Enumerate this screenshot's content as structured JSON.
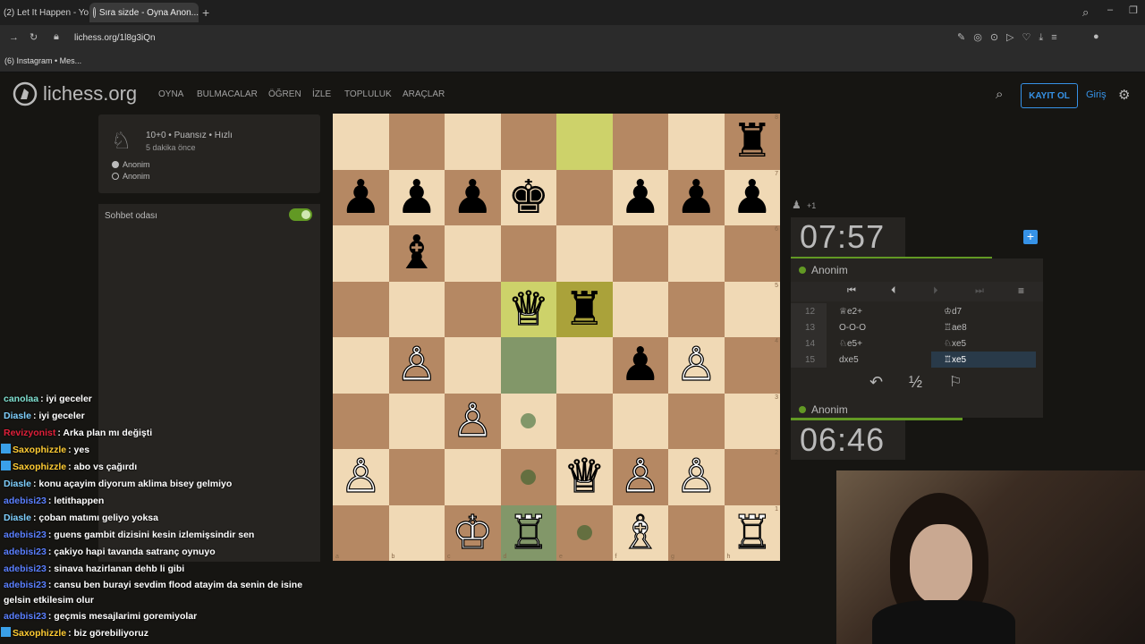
{
  "browser": {
    "tabs": [
      {
        "label": "(2) Let It Happen - Yo..."
      },
      {
        "label": "Sıra sizde - Oyna Anon..."
      }
    ],
    "url": "lichess.org/1l8g3iQn",
    "bookmark": "(6) Instagram • Mes..."
  },
  "header": {
    "logo": "lichess.org",
    "nav": [
      "OYNA",
      "BULMACALAR",
      "ÖĞREN",
      "İZLE",
      "TOPLULUK",
      "ARAÇLAR"
    ],
    "signup": "KAYIT OL",
    "login": "Giriş"
  },
  "game_info": {
    "mode": "10+0 • Puansız • Hızlı",
    "time_ago": "5 dakika önce",
    "white": "Anonim",
    "black": "Anonim"
  },
  "chat_room": {
    "label": "Sohbet odası"
  },
  "board": {
    "files": [
      "a",
      "b",
      "c",
      "d",
      "e",
      "f",
      "g",
      "h"
    ],
    "ranks": [
      "8",
      "7",
      "6",
      "5",
      "4",
      "3",
      "2",
      "1"
    ],
    "rows": [
      [
        "",
        "",
        "",
        "",
        "",
        "",
        "",
        "♜"
      ],
      [
        "♟",
        "♟",
        "♟",
        "♚",
        "",
        "♟",
        "♟",
        "♟"
      ],
      [
        "",
        "♝",
        "",
        "",
        "",
        "",
        "",
        ""
      ],
      [
        "",
        "",
        "",
        "♕",
        "♜",
        "",
        "",
        ""
      ],
      [
        "",
        "♙",
        "",
        "",
        "",
        "♟",
        "♙",
        ""
      ],
      [
        "",
        "",
        "♙",
        "",
        "",
        "",
        "",
        ""
      ],
      [
        "♙",
        "",
        "",
        "",
        "♕",
        "♙",
        "♙",
        ""
      ],
      [
        "",
        "",
        "♔",
        "♖",
        "",
        "♗",
        "",
        "♖"
      ]
    ]
  },
  "right": {
    "captured": "+1",
    "clock_top": "07:57",
    "player_top": "Anonim",
    "moves": [
      {
        "no": "12",
        "white": "♕e2+",
        "black": "♔d7"
      },
      {
        "no": "13",
        "white": "O-O-O",
        "black": "♖ae8"
      },
      {
        "no": "14",
        "white": "♘e5+",
        "black": "♘xe5"
      },
      {
        "no": "15",
        "white": "dxe5",
        "black": "♖xe5"
      }
    ],
    "draw_label": "½",
    "player_bottom": "Anonim",
    "clock_bottom": "06:46"
  },
  "chat": [
    {
      "user": "canolaa",
      "color": "#7fe0d0",
      "msg": ": iyi geceler",
      "badge": false
    },
    {
      "user": "Diasle",
      "color": "#7fd0ff",
      "msg": ": iyi geceler",
      "badge": false
    },
    {
      "user": "Revizyonist",
      "color": "#e0203a",
      "msg": ": Arka plan mı değişti",
      "badge": false
    },
    {
      "user": "Saxophizzle",
      "color": "#ffcc33",
      "msg": ": yes",
      "badge": true
    },
    {
      "user": "Saxophizzle",
      "color": "#ffcc33",
      "msg": ": abo vs çağırdı",
      "badge": true
    },
    {
      "user": "Diasle",
      "color": "#7fd0ff",
      "msg": ": konu açayim diyorum aklima bisey gelmiyo",
      "badge": false
    },
    {
      "user": "adebisi23",
      "color": "#5a7fff",
      "msg": ": letithappen",
      "badge": false
    },
    {
      "user": "Diasle",
      "color": "#7fd0ff",
      "msg": ": çoban matımı geliyo yoksa",
      "badge": false
    },
    {
      "user": "adebisi23",
      "color": "#5a7fff",
      "msg": ": guens gambit dizisini kesin izlemişsindir sen",
      "badge": false
    },
    {
      "user": "adebisi23",
      "color": "#5a7fff",
      "msg": ": çakiyo hapi tavanda satranç oynuyo",
      "badge": false
    },
    {
      "user": "adebisi23",
      "color": "#5a7fff",
      "msg": ": sinava hazirlanan dehb li gibi",
      "badge": false
    },
    {
      "user": "adebisi23",
      "color": "#5a7fff",
      "msg": ": cansu ben burayi sevdim flood atayim da senin de isine gelsin etkilesim olur",
      "badge": false
    },
    {
      "user": "adebisi23",
      "color": "#5a7fff",
      "msg": ": geçmis mesajlarimi goremiyolar",
      "badge": false
    },
    {
      "user": "Saxophizzle",
      "color": "#ffcc33",
      "msg": ": biz görebiliyoruz",
      "badge": true
    }
  ]
}
